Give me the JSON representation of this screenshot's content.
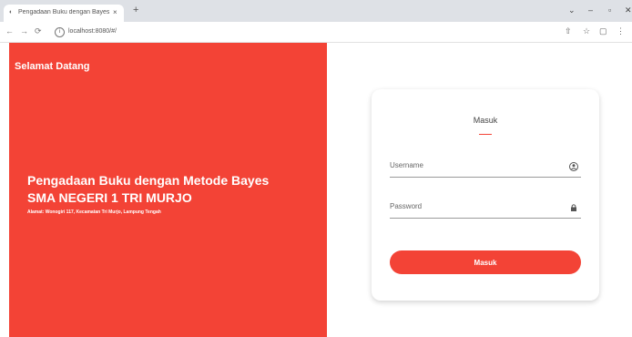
{
  "browser": {
    "tab_title": "Pengadaan Buku dengan Bayes",
    "tab_close": "×",
    "new_tab": "+",
    "url": "localhost:8080/#/",
    "window_controls": [
      "⌄",
      "–",
      "▫",
      "✕"
    ],
    "nav": {
      "back": "←",
      "forward": "→",
      "reload": "⟳"
    },
    "bar_icons": [
      "⇧",
      "☆",
      "▢",
      "⋮"
    ]
  },
  "left_panel": {
    "welcome": "Selamat Datang",
    "title": "Pengadaan Buku dengan Metode Bayes",
    "school": "SMA NEGERI 1 TRI MURJO",
    "address": "Alamat: Wonogiri 117, Kecamatan Tri Murjo, Lampung Tengah",
    "bg_color": "#f34336"
  },
  "login": {
    "title": "Masuk",
    "username_placeholder": "Username",
    "password_placeholder": "Password",
    "submit_label": "Masuk",
    "accent_color": "#f34336",
    "username_icon": "user-circle-icon",
    "password_icon": "lock-icon"
  }
}
